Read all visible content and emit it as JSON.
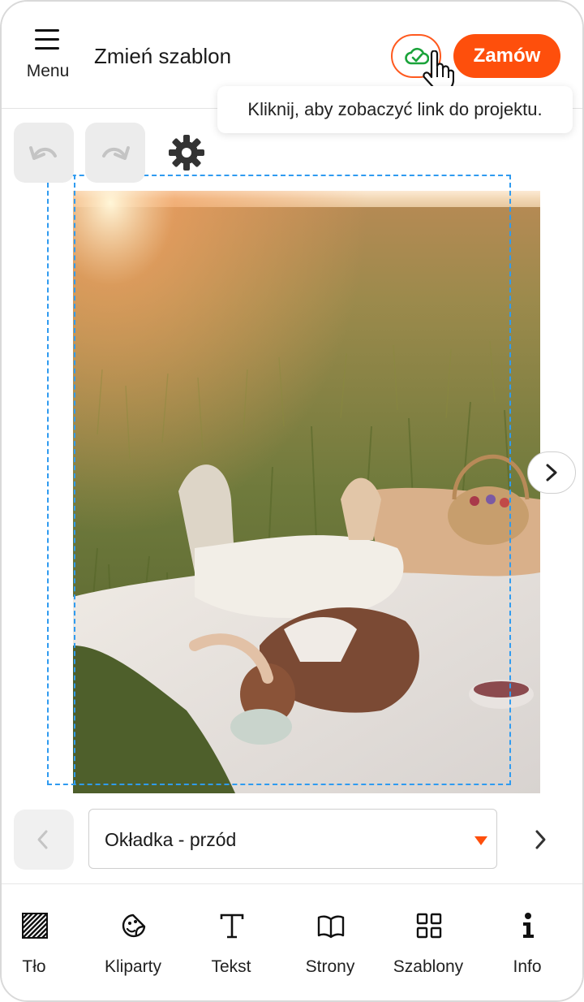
{
  "header": {
    "menu_label": "Menu",
    "title": "Zmień szablon",
    "order_label": "Zamów",
    "tooltip": "Kliknij, aby zobaczyć link do projektu."
  },
  "page_selector": {
    "selected": "Okładka - przód"
  },
  "toolbar": {
    "items": [
      {
        "label": "Tło",
        "icon": "background-pattern-icon"
      },
      {
        "label": "Kliparty",
        "icon": "sticker-icon"
      },
      {
        "label": "Tekst",
        "icon": "text-icon"
      },
      {
        "label": "Strony",
        "icon": "book-icon"
      },
      {
        "label": "Szablony",
        "icon": "grid-icon"
      },
      {
        "label": "Info",
        "icon": "info-icon"
      }
    ]
  },
  "colors": {
    "accent": "#fe4f0c",
    "save_check": "#1aa33a",
    "selection": "#2f9bf0"
  }
}
